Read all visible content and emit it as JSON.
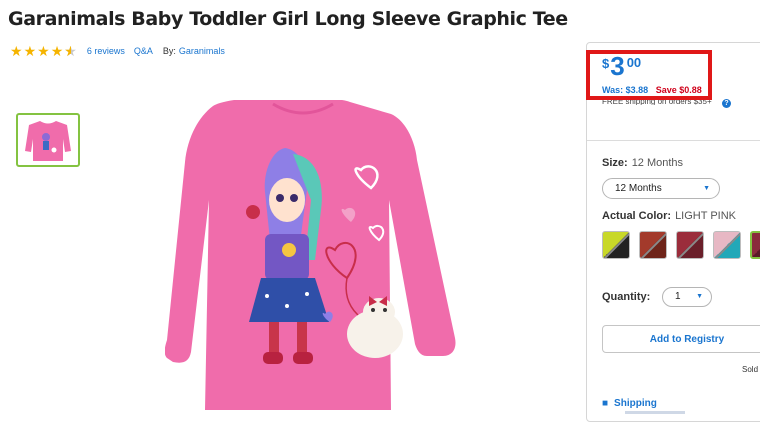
{
  "product": {
    "title": "Garanimals Baby Toddler Girl Long Sleeve Graphic Tee",
    "rating": 4.5,
    "reviews_label": "6 reviews",
    "qa_label": "Q&A",
    "by_label": "By:",
    "brand": "Garanimals"
  },
  "price": {
    "currency": "$",
    "whole": "3",
    "cents": "00",
    "was_label": "Was: $3.88",
    "save_label": "Save $0.88",
    "shipping_note": "FREE shipping on orders $35+"
  },
  "options": {
    "size_label": "Size:",
    "size_value": "12 Months",
    "size_select_value": "12 Months",
    "color_label": "Actual Color:",
    "color_value": "LIGHT PINK",
    "swatch_colors": [
      [
        "#c8d829",
        "#222222"
      ],
      [
        "#a33a2b",
        "#6e2419"
      ],
      [
        "#9b2d3b",
        "#6a1f2a"
      ],
      [
        "#e7b8c4",
        "#22a8b8"
      ],
      [
        "#8a2a3c",
        "#5b1828"
      ]
    ],
    "quantity_label": "Quantity:",
    "quantity_value": "1"
  },
  "actions": {
    "registry_label": "Add to Registry",
    "sold_label": "Sold",
    "shipping_label": "Shipping"
  },
  "colors": {
    "accent": "#1a75cf",
    "sale": "#d0021b",
    "highlight_box": "#e01818",
    "star": "#f5b400",
    "shirt": "#f06cab"
  }
}
